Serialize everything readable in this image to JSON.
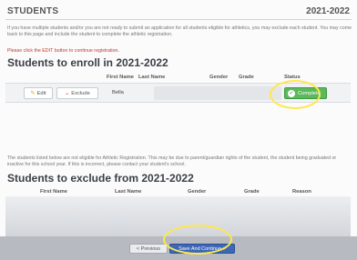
{
  "header": {
    "title": "STUDENTS",
    "year": "2021-2022"
  },
  "intro": "If you have multiple students and/or you are not ready to submit an application for all students eligible for athletics, you may exclude each student. You may come back to this page and include the student to complete the athletic registration.",
  "notice": "Please click the EDIT button to continue registration.",
  "enroll": {
    "heading": "Students to enroll in 2021-2022",
    "columns": [
      "First Name",
      "Last Name",
      "Gender",
      "Grade",
      "Status"
    ],
    "row": {
      "edit_label": "Edit",
      "exclude_label": "Exclude",
      "first_name": "Bella",
      "status": "Complete"
    }
  },
  "explanation": "The students listed below are not eligible for Athletic Registration. This may be due to parent/guardian rights of the student, the student being graduated or inactive for this school year. If this is incorrect, please contact your student's school.",
  "exclude": {
    "heading": "Students to exclude from 2021-2022",
    "columns": [
      "First Name",
      "Last Name",
      "Gender",
      "Grade",
      "Reason"
    ]
  },
  "footer": {
    "previous_label": "< Previous",
    "next_label": "Save And Continue >"
  },
  "colors": {
    "status_green": "#5cb85c",
    "next_blue": "#3d67b8",
    "highlight_yellow": "#ffe84a",
    "notice_red": "#c0392b"
  }
}
